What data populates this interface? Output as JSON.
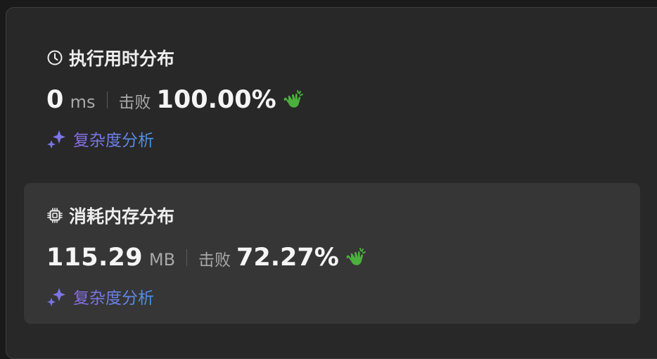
{
  "runtime": {
    "title": "执行用时分布",
    "icon": "clock-icon",
    "value": "0",
    "unit": "ms",
    "beat_label": "击败",
    "beat_percent": "100.00%",
    "beat_icon": "clapping-hands-icon",
    "analysis_label": "复杂度分析",
    "analysis_icon": "sparkle-icon"
  },
  "memory": {
    "title": "消耗内存分布",
    "icon": "chip-icon",
    "value": "115.29",
    "unit": "MB",
    "beat_label": "击败",
    "beat_percent": "72.27%",
    "beat_icon": "clapping-hands-icon",
    "analysis_label": "复杂度分析",
    "analysis_icon": "sparkle-icon"
  },
  "colors": {
    "background": "#282828",
    "selected_card": "#363636",
    "text_primary": "#f5f5f5",
    "text_secondary": "#a8a8a8",
    "clap_green": "#4caf3e",
    "sparkle_start": "#8a6de8",
    "sparkle_end": "#4f92e0"
  }
}
